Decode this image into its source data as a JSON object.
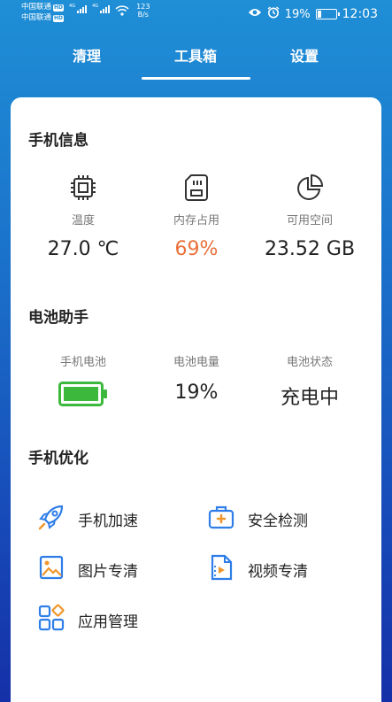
{
  "status_bar": {
    "carrier1": "中国联通",
    "carrier2": "中国联通",
    "hd": "HD",
    "net1": "4G",
    "net2": "4G",
    "speed_value": "123",
    "speed_unit": "B/s",
    "battery_percent": "19%",
    "time": "12:03"
  },
  "tabs": [
    {
      "label": "清理"
    },
    {
      "label": "工具箱"
    },
    {
      "label": "设置"
    }
  ],
  "phone_info": {
    "title": "手机信息",
    "items": [
      {
        "label": "温度",
        "value": "27.0 ℃",
        "icon": "chip-icon"
      },
      {
        "label": "内存占用",
        "value": "69%",
        "icon": "sd-card-icon"
      },
      {
        "label": "可用空间",
        "value": "23.52 GB",
        "icon": "pie-chart-icon"
      }
    ]
  },
  "battery": {
    "title": "电池助手",
    "items": [
      {
        "label": "手机电池",
        "icon": "battery-full-icon"
      },
      {
        "label": "电池电量",
        "value": "19%"
      },
      {
        "label": "电池状态",
        "value": "充电中"
      }
    ]
  },
  "optimize": {
    "title": "手机优化",
    "items": [
      {
        "label": "手机加速",
        "icon": "rocket-icon"
      },
      {
        "label": "安全检测",
        "icon": "first-aid-kit-icon"
      },
      {
        "label": "图片专清",
        "icon": "image-icon"
      },
      {
        "label": "视频专清",
        "icon": "video-file-icon"
      },
      {
        "label": "应用管理",
        "icon": "apps-grid-icon"
      }
    ]
  },
  "colors": {
    "accent_blue": "#2f7ee8",
    "accent_orange": "#f0962d",
    "battery_green": "#3cb83c",
    "value_orange": "#e8703a"
  }
}
